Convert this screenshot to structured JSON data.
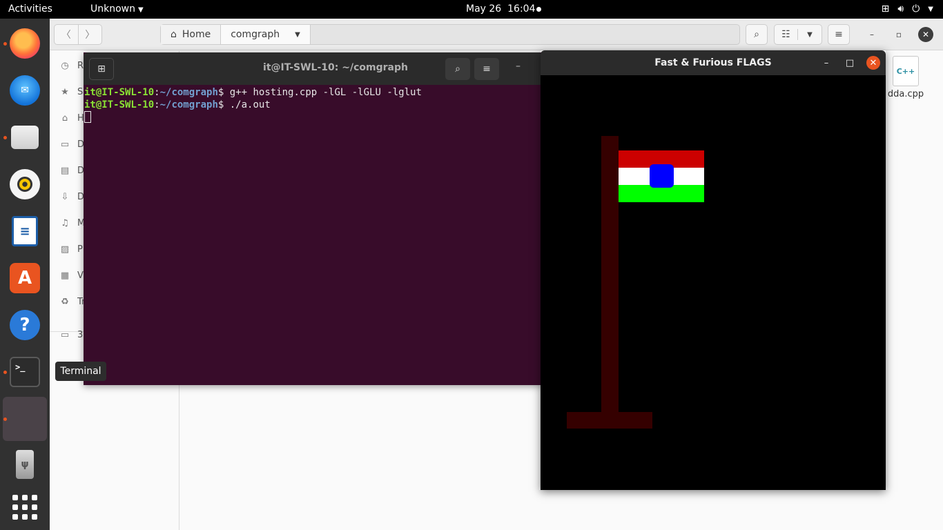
{
  "topbar": {
    "activities": "Activities",
    "app_menu": "Unknown",
    "date": "May 26",
    "time": "16:04"
  },
  "dock": {
    "apps": [
      {
        "name": "Firefox",
        "running": true
      },
      {
        "name": "Thunderbird",
        "running": false
      },
      {
        "name": "Files",
        "running": true
      },
      {
        "name": "Rhythmbox",
        "running": false
      },
      {
        "name": "LibreOffice Writer",
        "running": false
      },
      {
        "name": "Ubuntu Software",
        "running": false
      },
      {
        "name": "Help",
        "running": false
      },
      {
        "name": "Terminal",
        "running": true
      },
      {
        "name": "Fast & Furious FLAGS",
        "running": true
      },
      {
        "name": "USB Drive",
        "running": false
      },
      {
        "name": "Show Applications",
        "running": false
      }
    ],
    "tooltip": "Terminal"
  },
  "file_manager": {
    "breadcrumbs": [
      "Home",
      "comgraph"
    ],
    "sidebar": [
      "R",
      "S",
      "H",
      "D",
      "D",
      "D",
      "M",
      "P",
      "V",
      "Tr",
      "3"
    ],
    "files": [
      {
        "name": "dda.cpp",
        "badge": "C++"
      }
    ]
  },
  "terminal": {
    "title": "it@IT-SWL-10: ~/comgraph",
    "prompt_user": "it@IT-SWL-10",
    "prompt_path": "~/comgraph",
    "lines": [
      {
        "cmd": "g++ hosting.cpp -lGL -lGLU -lglut"
      },
      {
        "cmd": "./a.out"
      }
    ]
  },
  "gl_window": {
    "title": "Fast & Furious FLAGS",
    "colors": {
      "background": "#000000",
      "pole": "#350000",
      "stripe_top": "#cc0000",
      "stripe_middle": "#ffffff",
      "stripe_bottom": "#00ff00",
      "center": "#0000ff"
    }
  }
}
